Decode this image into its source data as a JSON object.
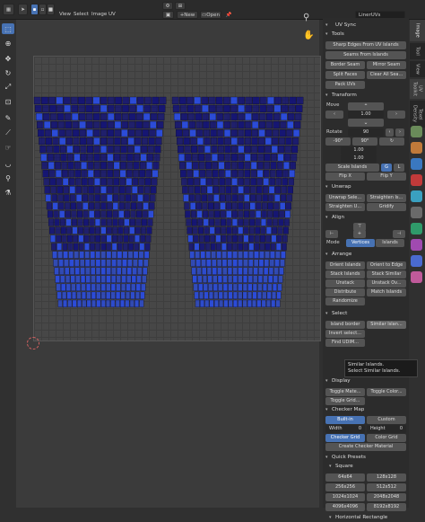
{
  "header": {
    "menus": [
      "View",
      "Select",
      "Image",
      "UV"
    ],
    "new_label": "New",
    "open_label": "Open",
    "uv_name": "LinerUVs"
  },
  "npanel": {
    "uv_sync": "UV Sync",
    "tools": {
      "title": "Tools",
      "sharp_edges": "Sharp Edges From UV Islands",
      "seams_from_islands": "Seams From Islands",
      "border_seam": "Border Seam",
      "mirror_seam": "Mirror Seam",
      "split_faces": "Split Faces",
      "clear_all_seams": "Clear All Sea...",
      "pack_uvs": "Pack UVs"
    },
    "transform": {
      "title": "Transform",
      "move_label": "Move",
      "move_value": "1.00",
      "rotate_label": "Rotate",
      "rotate_value": "90",
      "rot_neg": "-90°",
      "rot_pos": "90°",
      "scale_x": "1.00",
      "scale_y": "1.00",
      "scale_islands": "Scale Islands",
      "flip_x": "Flip X",
      "flip_y": "Flip Y"
    },
    "unwrap": {
      "title": "Unwrap",
      "unwrap_sele": "Unwrap Sele...",
      "straighten_is": "Straighten Is...",
      "straighten_u": "Straighten U...",
      "gridify": "Gridify"
    },
    "align": {
      "title": "Align",
      "mode_label": "Mode",
      "mode_vertices": "Vertices",
      "mode_islands": "Islands"
    },
    "arrange": {
      "title": "Arrange",
      "orient_islands": "Orient Islands",
      "orient_to_edge": "Orient to Edge",
      "stack_islands": "Stack Islands",
      "stack_similar": "Stack Similar",
      "unstack": "Unstack",
      "unstack_ov": "Unstack Ov...",
      "distribute": "Distribute",
      "match_islands": "Match Islands",
      "randomize": "Randomize"
    },
    "select": {
      "title": "Select",
      "island_border": "Island border",
      "similar_islands": "Similar Islan...",
      "invert_select": "Invert select...",
      "find_udim": "Find UDIM..."
    },
    "display": {
      "title": "Display",
      "toggle_mate": "Toggle Mate...",
      "toggle_color": "Toggle Color...",
      "toggle_grid": "Toggle Grid..."
    },
    "checker_map": {
      "title": "Checker Map",
      "built_in": "Built-in",
      "custom": "Custom",
      "width_label": "Width",
      "width_value": "0",
      "height_label": "Height",
      "height_value": "0",
      "checker_grid": "Checker Grid",
      "color_grid": "Color Grid",
      "create_checker": "Create Checker Material"
    },
    "quick_presets": {
      "title": "Quick Presets",
      "square_label": "Square",
      "sizes": [
        "64x64",
        "128x128",
        "256x256",
        "512x512",
        "1024x1024",
        "2048x2048",
        "4096x4096",
        "8192x8192"
      ],
      "horizontal_rect": "Horizontal Rectangle"
    }
  },
  "tooltip": {
    "line1": "Similar Islands.",
    "line2": "Select Similar Islands."
  },
  "sidetabs": [
    "Image",
    "Tool",
    "View",
    "UV Toolkit",
    "Texel Density"
  ],
  "colors": {
    "accent": "#4772b3",
    "island_dark": "#10107a",
    "island_bright": "#2a4de0"
  }
}
